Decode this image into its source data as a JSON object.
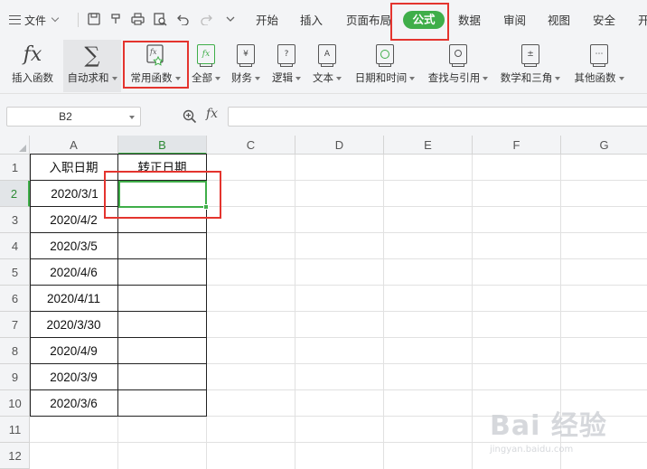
{
  "menubar": {
    "file_label": "文件",
    "tabs": [
      "开始",
      "插入",
      "页面布局",
      "公式",
      "数据",
      "审阅",
      "视图",
      "安全",
      "开"
    ],
    "active_tab": "公式"
  },
  "ribbon": {
    "insert_function": "插入函数",
    "auto_sum": "自动求和",
    "common_functions": "常用函数",
    "all": "全部",
    "financial": "财务",
    "logical": "逻辑",
    "text": "文本",
    "date_time": "日期和时间",
    "lookup": "查找与引用",
    "math_trig": "数学和三角",
    "other": "其他函数"
  },
  "formula_bar": {
    "name_box": "B2",
    "fx": "fx",
    "formula": ""
  },
  "grid": {
    "columns": [
      "A",
      "B",
      "C",
      "D",
      "E",
      "F",
      "G"
    ],
    "selected_column": "B",
    "rows": [
      "1",
      "2",
      "3",
      "4",
      "5",
      "6",
      "7",
      "8",
      "9",
      "10",
      "11",
      "12"
    ],
    "selected_row": "2",
    "cells": {
      "A1": "入职日期",
      "B1": "转正日期",
      "A2": "2020/3/1",
      "A3": "2020/4/2",
      "A4": "2020/3/5",
      "A5": "2020/4/6",
      "A6": "2020/4/11",
      "A7": "2020/3/30",
      "A8": "2020/4/9",
      "A9": "2020/3/9",
      "A10": "2020/3/6"
    }
  },
  "watermark": {
    "logo": "Bai 经验",
    "url": "jingyan.baidu.com"
  },
  "colors": {
    "accent_green": "#3fae49",
    "annotation_red": "#e4342e"
  }
}
